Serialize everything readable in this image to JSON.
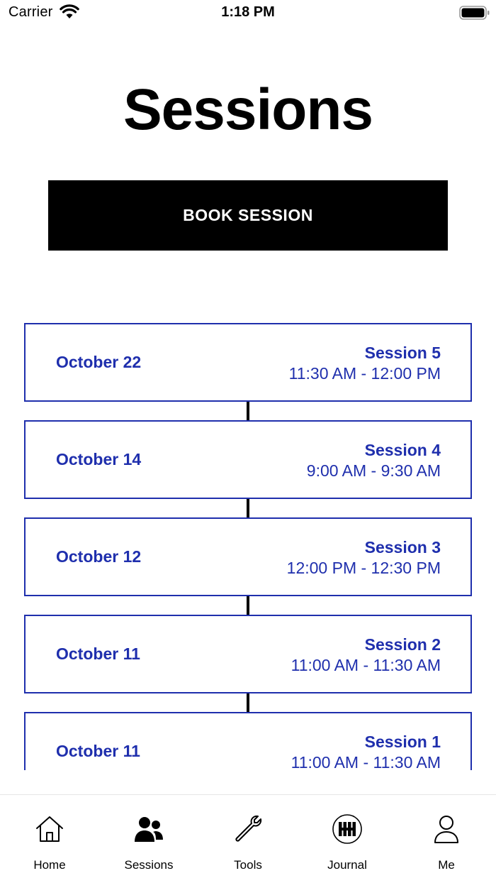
{
  "status_bar": {
    "carrier": "Carrier",
    "time": "1:18 PM"
  },
  "page": {
    "title": "Sessions",
    "book_button_label": "BOOK SESSION"
  },
  "colors": {
    "accent": "#1f2fad",
    "button_bg": "#000000",
    "connector": "#000000"
  },
  "sessions": [
    {
      "date": "October 22",
      "name": "Session 5",
      "time": "11:30 AM - 12:00 PM"
    },
    {
      "date": "October 14",
      "name": "Session 4",
      "time": "9:00 AM - 9:30 AM"
    },
    {
      "date": "October 12",
      "name": "Session 3",
      "time": "12:00 PM - 12:30 PM"
    },
    {
      "date": "October 11",
      "name": "Session 2",
      "time": "11:00 AM - 11:30 AM"
    },
    {
      "date": "October 11",
      "name": "Session 1",
      "time": "11:00 AM - 11:30 AM"
    }
  ],
  "tab_bar": {
    "active": "Sessions",
    "tabs": [
      {
        "label": "Home",
        "icon": "home-icon"
      },
      {
        "label": "Sessions",
        "icon": "people-icon"
      },
      {
        "label": "Tools",
        "icon": "wrench-icon"
      },
      {
        "label": "Journal",
        "icon": "journal-logo-icon"
      },
      {
        "label": "Me",
        "icon": "person-icon"
      }
    ]
  }
}
